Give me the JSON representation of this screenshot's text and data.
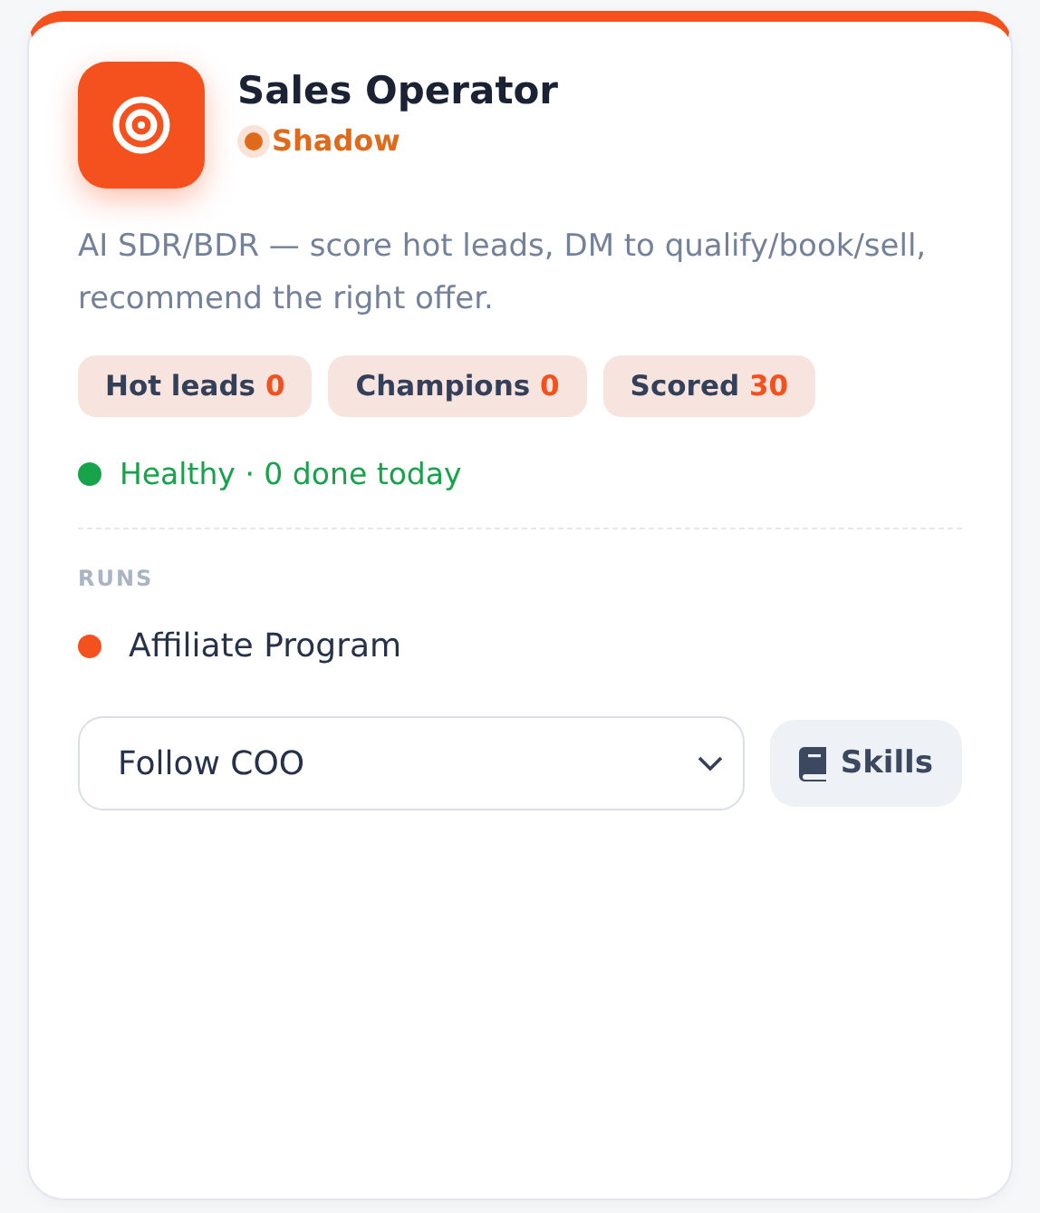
{
  "agent": {
    "name": "Sales Operator",
    "mode": {
      "label": "Shadow",
      "color": "#e06a1b"
    },
    "description": "AI SDR/BDR — score hot leads, DM to qualify/book/sell, recommend the right offer."
  },
  "stats": [
    {
      "label": "Hot leads",
      "value": "0"
    },
    {
      "label": "Champions",
      "value": "0"
    },
    {
      "label": "Scored",
      "value": "30"
    }
  ],
  "health": {
    "text": "Healthy · 0 done today",
    "color": "#16a34a"
  },
  "runs": {
    "heading": "RUNS",
    "items": [
      {
        "name": "Affiliate Program",
        "color": "#f4511e"
      }
    ]
  },
  "controls": {
    "select": {
      "value": "Follow COO"
    },
    "skills_button": "Skills"
  }
}
